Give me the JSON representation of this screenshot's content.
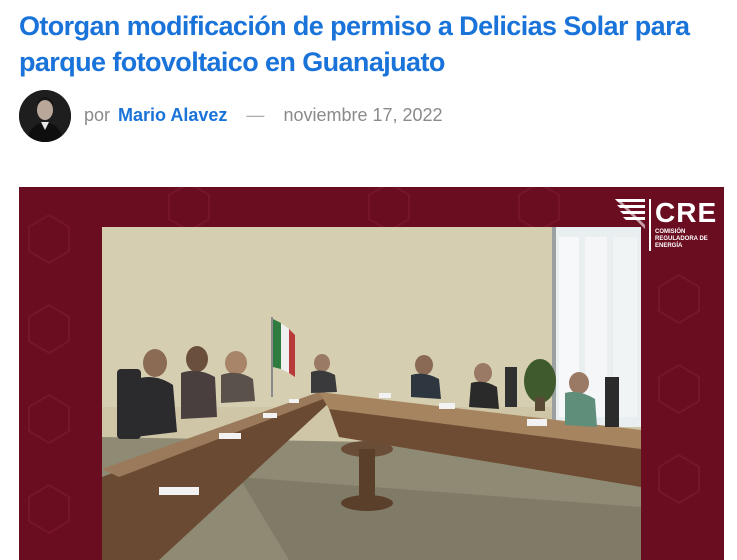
{
  "article": {
    "title": "Otorgan modificación de permiso a Delicias Solar para parque fotovoltaico en Guanajuato"
  },
  "byline": {
    "prefix": "por",
    "author": "Mario Alavez",
    "separator": "—",
    "date": "noviembre 17, 2022"
  },
  "image": {
    "logo_text": "CRE",
    "logo_subtitle": "Comisión Reguladora de Energía"
  },
  "colors": {
    "link": "#1a73d9",
    "meta_gray": "#8a8a8a",
    "frame_maroon": "#6d0e22"
  },
  "icons": [
    "author-avatar",
    "cre-logo-icon"
  ]
}
